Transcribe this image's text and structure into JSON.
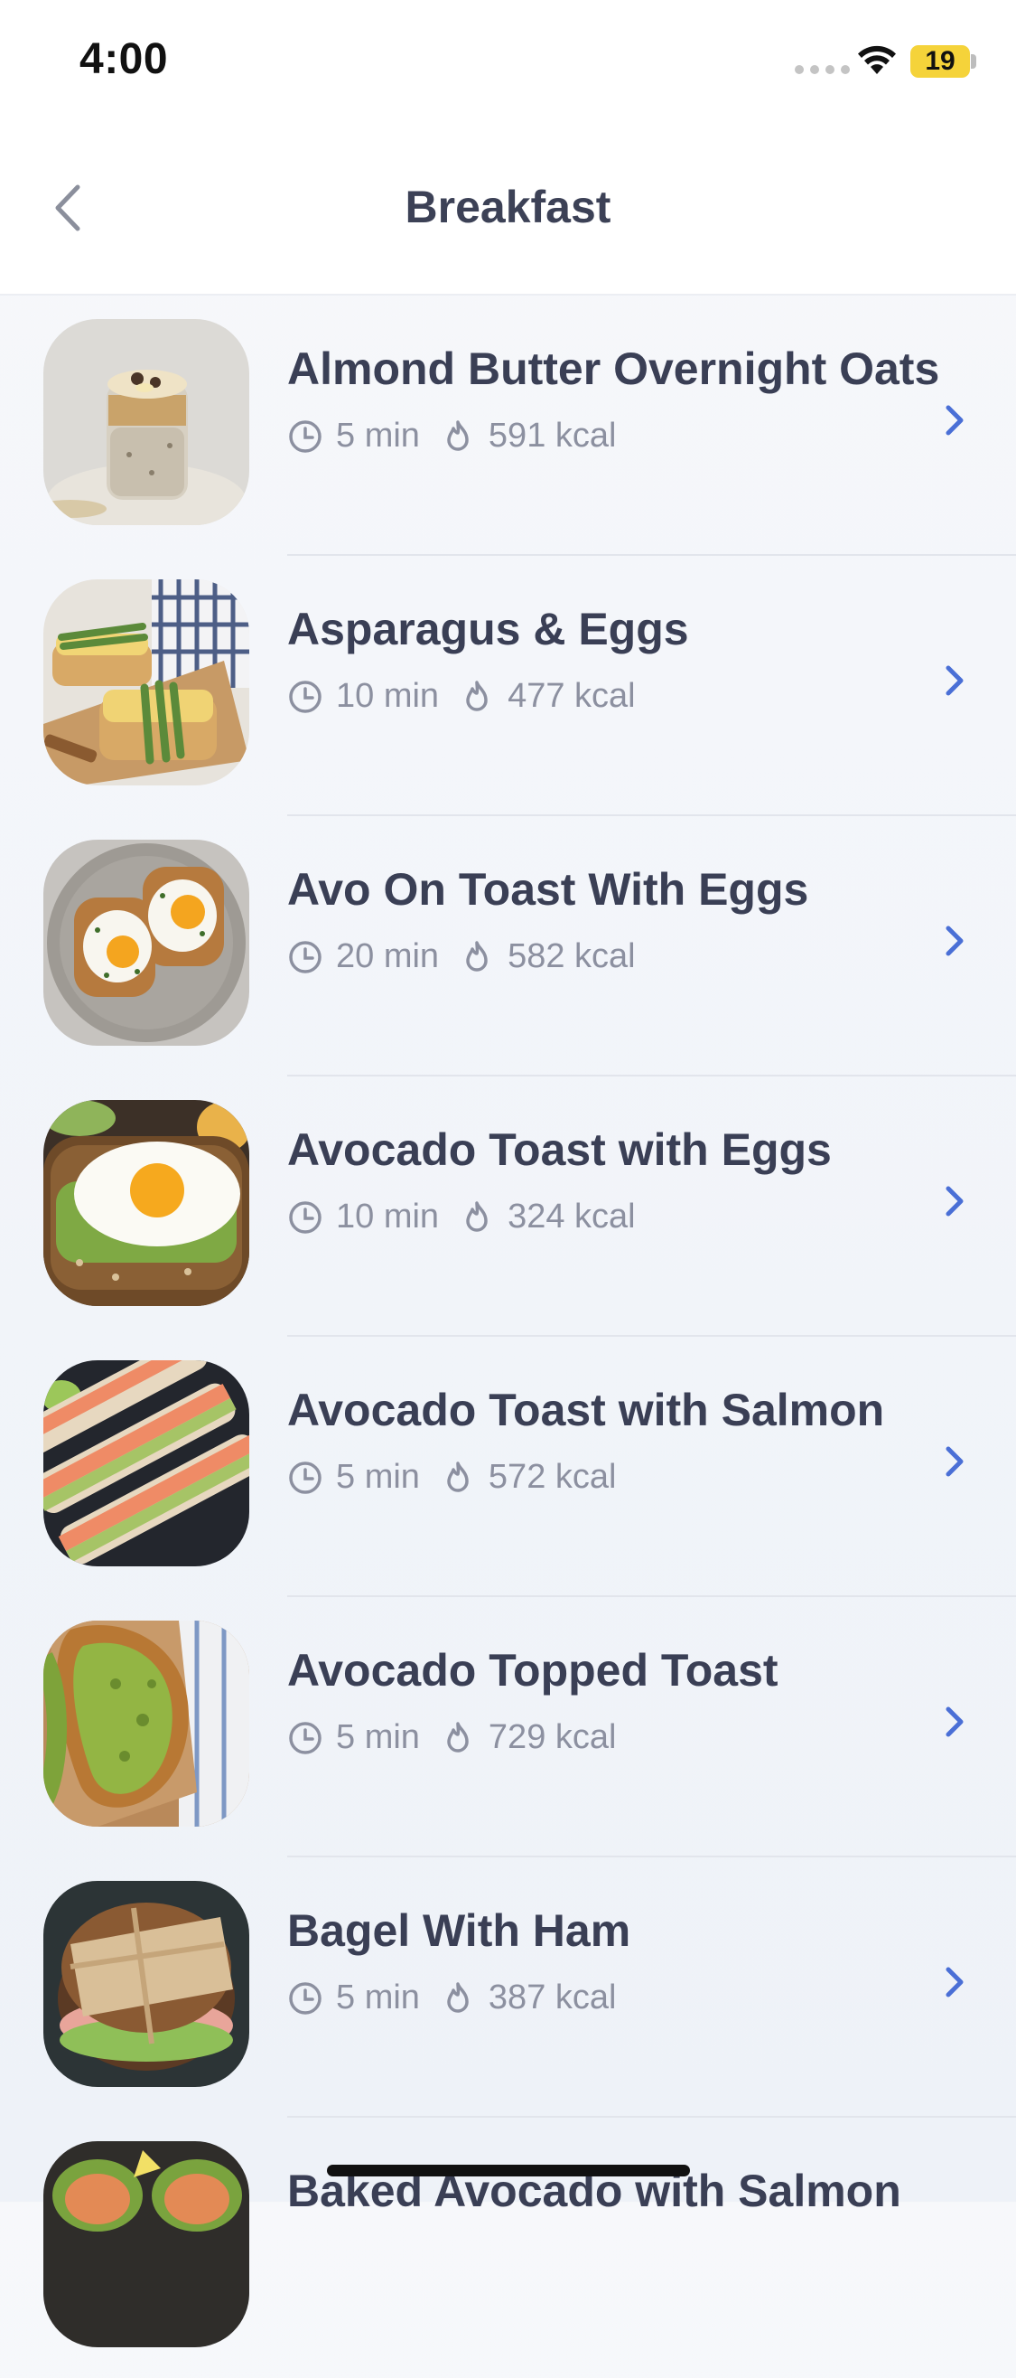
{
  "status_bar": {
    "time": "4:00",
    "battery": "19",
    "battery_color": "#f5d33a"
  },
  "nav": {
    "title": "Breakfast",
    "back_icon": "chevron-left-icon"
  },
  "accent_color": "#4a6fd6",
  "recipes": [
    {
      "name": "Almond Butter Overnight Oats",
      "time": "5 min",
      "kcal": "591 kcal"
    },
    {
      "name": "Asparagus & Eggs",
      "time": "10 min",
      "kcal": "477 kcal"
    },
    {
      "name": "Avo On Toast With Eggs",
      "time": "20 min",
      "kcal": "582 kcal"
    },
    {
      "name": "Avocado Toast with Eggs",
      "time": "10 min",
      "kcal": "324 kcal"
    },
    {
      "name": "Avocado Toast with Salmon",
      "time": "5 min",
      "kcal": "572 kcal"
    },
    {
      "name": "Avocado Topped Toast",
      "time": "5 min",
      "kcal": "729 kcal"
    },
    {
      "name": "Bagel With Ham",
      "time": "5 min",
      "kcal": "387 kcal"
    },
    {
      "name": "Baked Avocado with Salmon",
      "time": "",
      "kcal": ""
    }
  ]
}
